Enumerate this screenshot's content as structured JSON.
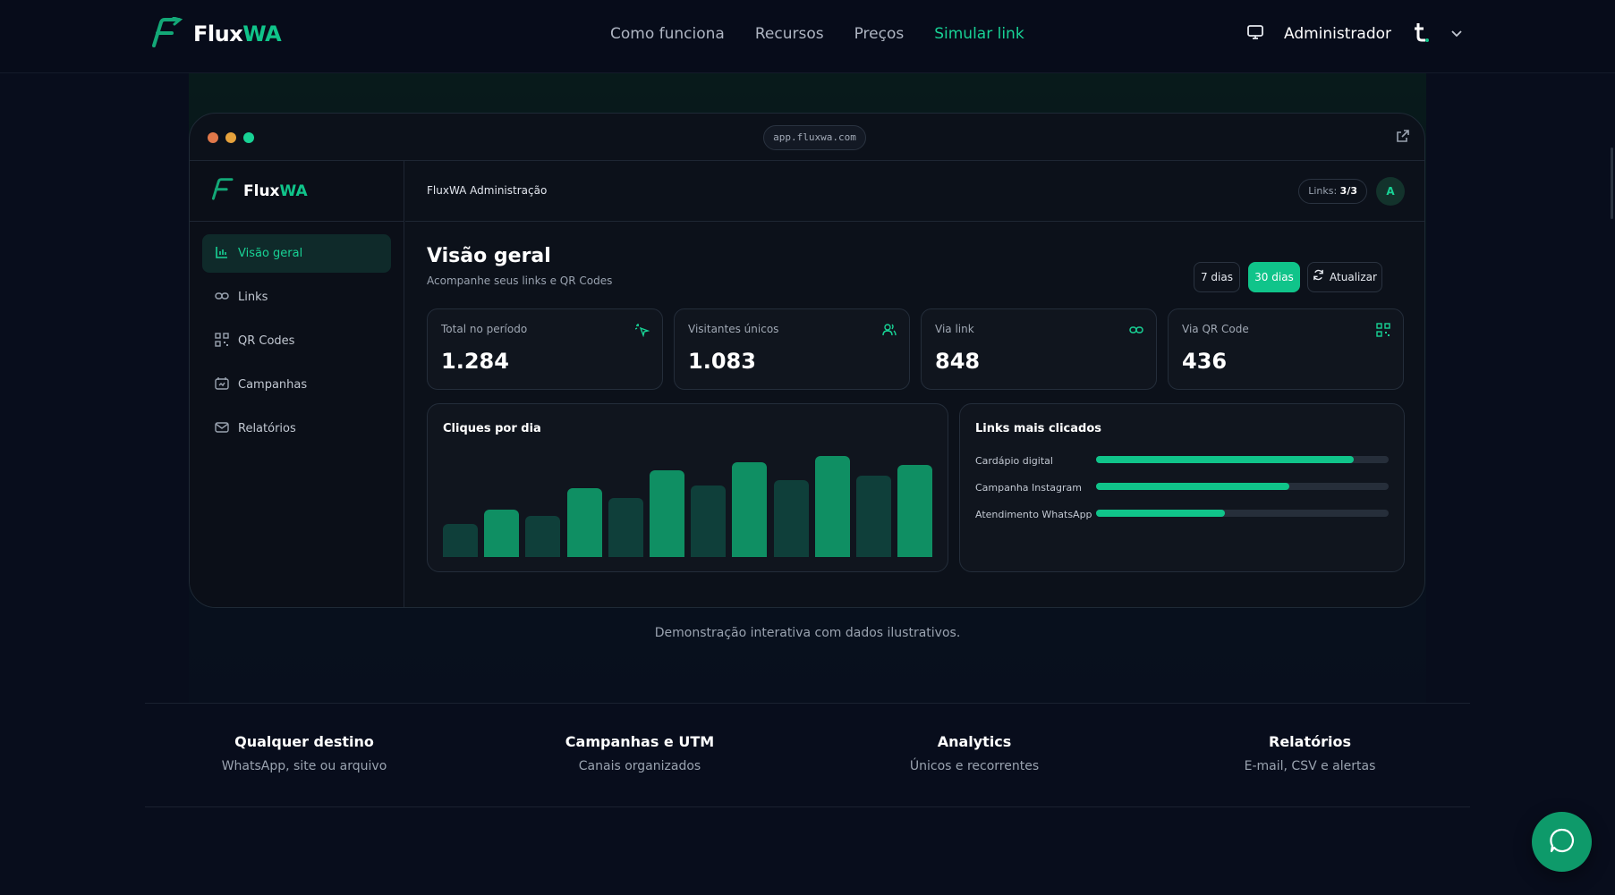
{
  "nav": {
    "brand_a": "Flux",
    "brand_b": "WA",
    "links": [
      "Como funciona",
      "Recursos",
      "Preços",
      "Simular link"
    ],
    "admin_label": "Administrador"
  },
  "window": {
    "url": "app.fluxwa.com",
    "dots": [
      "#e0784a",
      "#e6a23c",
      "#18d295"
    ]
  },
  "app": {
    "brand_a": "Flux",
    "brand_b": "WA",
    "menu": [
      {
        "label": "Visão geral",
        "icon": "bar-chart-icon"
      },
      {
        "label": "Links",
        "icon": "link-icon"
      },
      {
        "label": "QR Codes",
        "icon": "qr-code-icon"
      },
      {
        "label": "Campanhas",
        "icon": "campaign-icon"
      },
      {
        "label": "Relatórios",
        "icon": "mail-icon"
      }
    ],
    "topbar_title": "FluxWA Administração",
    "links_badge_label": "Links:",
    "links_badge_value": "3/3",
    "avatar": "A"
  },
  "overview": {
    "title": "Visão geral",
    "subtitle": "Acompanhe seus links e QR Codes",
    "range_7": "7 dias",
    "range_30": "30 dias",
    "refresh": "Atualizar",
    "cards": [
      {
        "label": "Total no período",
        "value": "1.284",
        "icon": "pointer-click-icon"
      },
      {
        "label": "Visitantes únicos",
        "value": "1.083",
        "icon": "users-icon"
      },
      {
        "label": "Via link",
        "value": "848",
        "icon": "link-icon"
      },
      {
        "label": "Via QR Code",
        "value": "436",
        "icon": "qr-code-icon"
      }
    ]
  },
  "chart_data": {
    "type": "bar",
    "title": "Cliques por dia",
    "values": [
      32,
      46,
      40,
      67,
      57,
      84,
      70,
      92,
      75,
      98,
      79,
      90
    ],
    "colors": [
      "#0f3f3a",
      "#0f8f63"
    ]
  },
  "top_links": {
    "title": "Links mais clicados",
    "items": [
      {
        "label": "Cardápio digital",
        "percent": 88
      },
      {
        "label": "Campanha Instagram",
        "percent": 66
      },
      {
        "label": "Atendimento WhatsApp",
        "percent": 44
      }
    ]
  },
  "demo_note": "Demonstração interativa com dados ilustrativos.",
  "features": [
    {
      "title": "Qualquer destino",
      "subtitle": "WhatsApp, site ou arquivo"
    },
    {
      "title": "Campanhas e UTM",
      "subtitle": "Canais organizados"
    },
    {
      "title": "Analytics",
      "subtitle": "Únicos e recorrentes"
    },
    {
      "title": "Relatórios",
      "subtitle": "E-mail, CSV e alertas"
    }
  ]
}
